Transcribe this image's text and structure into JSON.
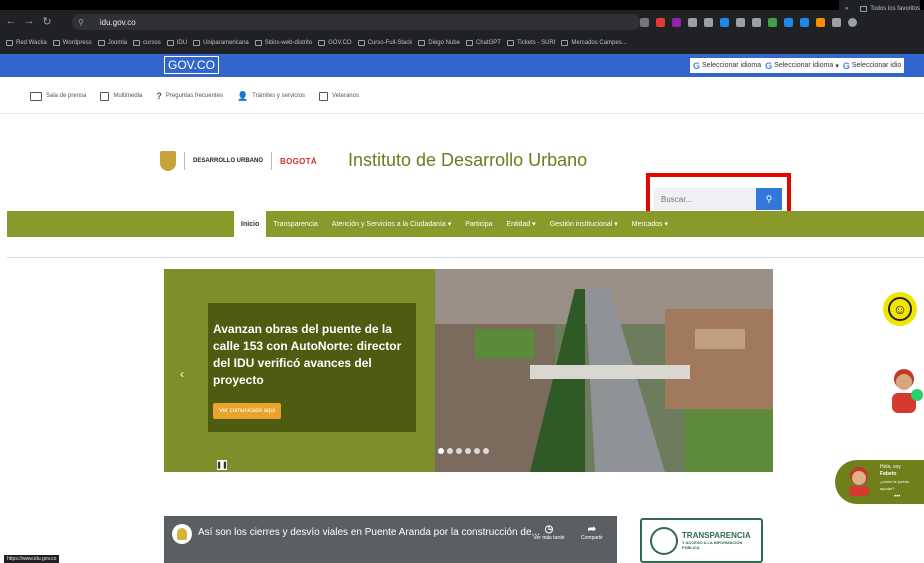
{
  "browser": {
    "url": "idu.gov.co",
    "bookmarks": [
      "Red Wacka",
      "Wordpress",
      "Joomla",
      "cursos",
      "IDU",
      "Uniparamericana",
      "Sitios-web-distrito",
      "GOV.CO",
      "Curso-Full-Stack",
      "Diego Nube",
      "ChatGPT",
      "Tickets - SURI",
      "Mercados Campes..."
    ],
    "bookmarks_right": "Todos los favoritos",
    "status_url": "https://www.idu.gov.co"
  },
  "gov_bar": {
    "logo": "GOV.CO",
    "lang_label_1": "Seleccionar idioma",
    "lang_label_2": "Seleccionar idioma",
    "lang_label_3": "Seleccionar idio"
  },
  "top_nav": [
    "Sala de prensa",
    "Multimedia",
    "Preguntas frecuentes",
    "Trámites y servicios",
    "Veteranos"
  ],
  "header": {
    "idu_logo_line1": "DESARROLLO URBANO",
    "bogota_logo": "BOGOTÁ",
    "title": "Instituto de Desarrollo Urbano"
  },
  "search": {
    "placeholder": "Buscar...",
    "button_icon": "search-icon"
  },
  "main_menu": [
    {
      "label": "Inicio",
      "active": true
    },
    {
      "label": "Transparencia",
      "active": false
    },
    {
      "label": "Atención y Servicios a la Ciudadanía ▾",
      "active": false
    },
    {
      "label": "Participa",
      "active": false
    },
    {
      "label": "Entidad ▾",
      "active": false
    },
    {
      "label": "Gestión institucional ▾",
      "active": false
    },
    {
      "label": "Mercados ▾",
      "active": false
    }
  ],
  "hero": {
    "title": "Avanzan obras del puente de la calle 153 con AutoNorte: director del IDU verificó avances del proyecto",
    "button": "Ver comunicado aquí",
    "prev_icon": "‹",
    "pause_icon": "❚❚"
  },
  "chat": {
    "line1": "Hola, soy",
    "line2": "Fabeto",
    "line3": "¿cómo te puedo ayudar?"
  },
  "video": {
    "title": "Así son los cierres y desvío viales en Puente Aranda por la construcción de...",
    "watch_later": "Ver más tarde",
    "share": "Compartir"
  },
  "transparencia": {
    "title": "TRANSPARENCIA",
    "subtitle": "Y ACCESO A LA INFORMACIÓN PÚBLICA"
  },
  "colors": {
    "gov_blue": "#3366cc",
    "menu_green": "#8a9a2a",
    "highlight_red": "#e10600",
    "search_blue": "#3377dd"
  }
}
